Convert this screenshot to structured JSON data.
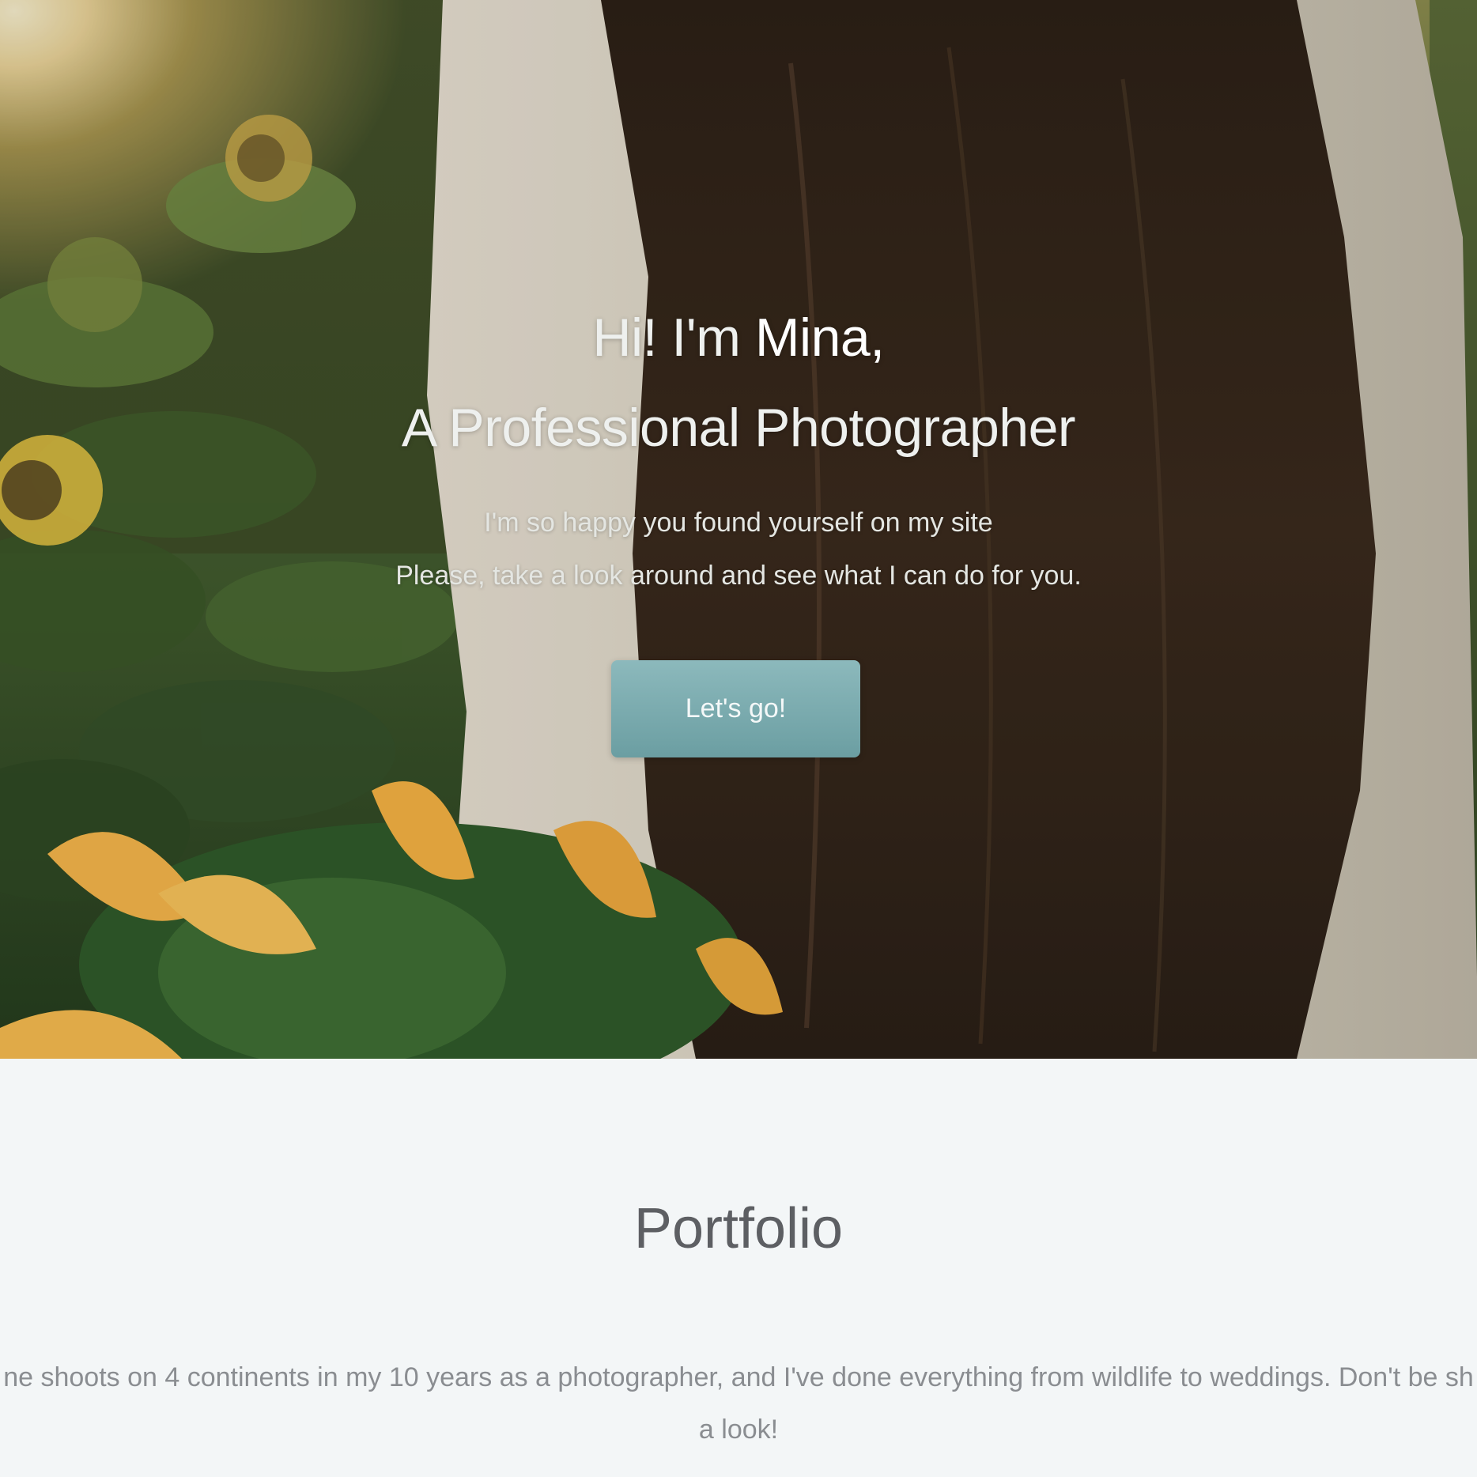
{
  "hero": {
    "greeting": "Hi! I'm ",
    "name": "Mina,",
    "role": "A Professional Photographer",
    "subtitle_line1": "I'm so happy you found yourself on my site",
    "subtitle_line2": "Please, take a look around and see what I can do for you.",
    "cta_label": "Let's go!",
    "cta_color": "#7aacaf"
  },
  "portfolio": {
    "title": "Portfolio",
    "text_line1": "ne shoots on 4 continents in my 10 years as a photographer, and I've done everything from wildlife to weddings. Don't be sh",
    "text_line2": "a look!"
  }
}
